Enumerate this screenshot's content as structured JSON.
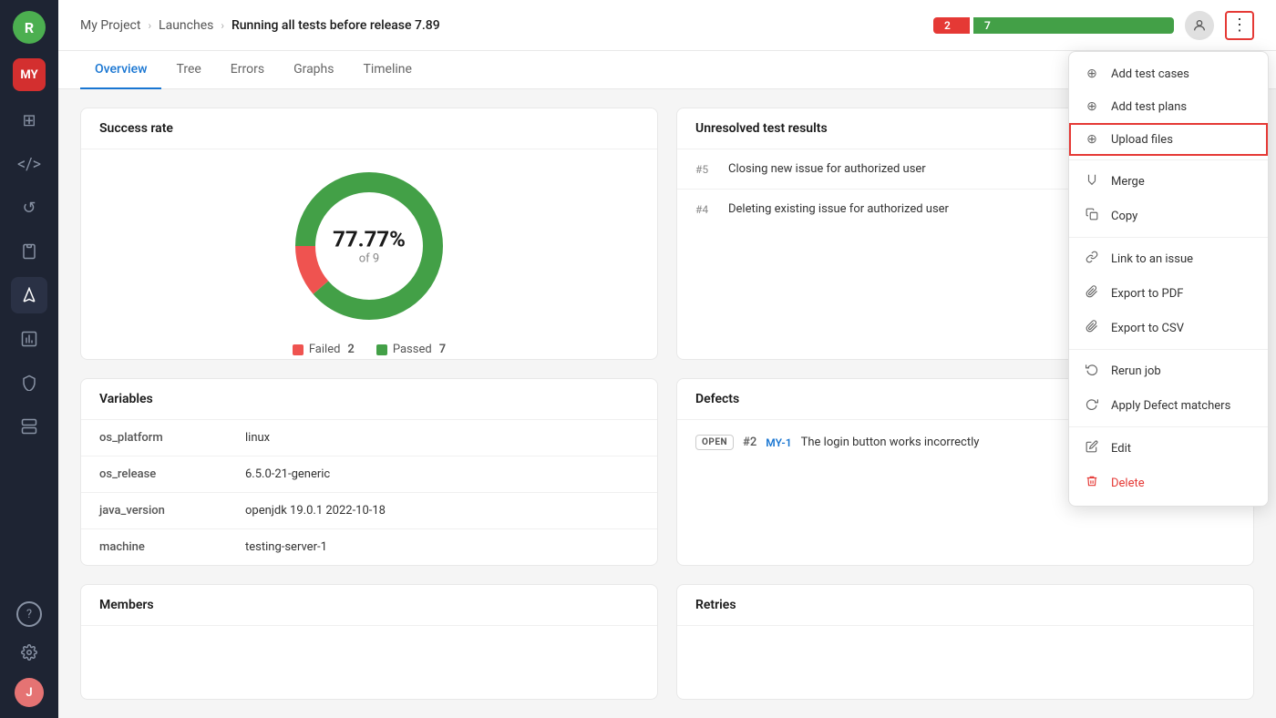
{
  "sidebar": {
    "logo_text": "R",
    "avatar_text": "MY",
    "icons": [
      {
        "name": "dashboard-icon",
        "glyph": "⊞",
        "active": false
      },
      {
        "name": "code-icon",
        "glyph": "⟨⟩",
        "active": false
      },
      {
        "name": "refresh-icon",
        "glyph": "↺",
        "active": false
      },
      {
        "name": "clipboard-icon",
        "glyph": "📋",
        "active": false
      },
      {
        "name": "launch-icon",
        "glyph": "🚀",
        "active": true
      },
      {
        "name": "chart-icon",
        "glyph": "📊",
        "active": false
      },
      {
        "name": "security-icon",
        "glyph": "🛡",
        "active": false
      },
      {
        "name": "storage-icon",
        "glyph": "🗄",
        "active": false
      }
    ],
    "bottom_icons": [
      {
        "name": "help-icon",
        "glyph": "?"
      },
      {
        "name": "settings-icon",
        "glyph": "⚙"
      },
      {
        "name": "user-icon",
        "glyph": "J",
        "is_avatar": true
      }
    ]
  },
  "breadcrumb": {
    "items": [
      "My Project",
      "Launches",
      "Running all tests before release 7.89"
    ]
  },
  "header": {
    "failed_count": "2",
    "passed_count": "7",
    "passed_bar_width": 220,
    "failed_bar_width": 40
  },
  "tabs": [
    {
      "label": "Overview",
      "active": true
    },
    {
      "label": "Tree",
      "active": false
    },
    {
      "label": "Errors",
      "active": false
    },
    {
      "label": "Graphs",
      "active": false
    },
    {
      "label": "Timeline",
      "active": false
    }
  ],
  "success_rate": {
    "title": "Success rate",
    "percent": "77.77%",
    "of": "of 9",
    "failed_count": 2,
    "passed_count": 7,
    "failed_label": "Failed",
    "passed_label": "Passed",
    "failed_color": "#ef5350",
    "passed_color": "#43a047",
    "donut_circumference": 502.65,
    "passed_dash": 390,
    "failed_dash": 112.65
  },
  "variables": {
    "title": "Variables",
    "rows": [
      {
        "key": "os_platform",
        "value": "linux"
      },
      {
        "key": "os_release",
        "value": "6.5.0-21-generic"
      },
      {
        "key": "java_version",
        "value": "openjdk 19.0.1 2022-10-18"
      },
      {
        "key": "machine",
        "value": "testing-server-1"
      }
    ]
  },
  "unresolved": {
    "title": "Unresolved test results",
    "items": [
      {
        "num": "#5",
        "text": "Closing new issue for authorized user"
      },
      {
        "num": "#4",
        "text": "Deleting existing issue for authorized user"
      }
    ]
  },
  "defects": {
    "title": "Defects",
    "items": [
      {
        "badge": "OPEN",
        "issue_num": "#2",
        "issue_link": "MY-1",
        "text": "The login button works incorrectly"
      }
    ]
  },
  "members": {
    "title": "Members"
  },
  "retries": {
    "title": "Retries"
  },
  "dropdown": {
    "items": [
      {
        "label": "Add test cases",
        "icon": "⊕",
        "highlighted": false
      },
      {
        "label": "Add test plans",
        "icon": "⊕",
        "highlighted": false
      },
      {
        "label": "Upload files",
        "icon": "⊕",
        "highlighted": true
      },
      {
        "label": "Merge",
        "icon": "⤢",
        "highlighted": false
      },
      {
        "label": "Copy",
        "icon": "⧉",
        "highlighted": false
      },
      {
        "label": "Link to an issue",
        "icon": "🔗",
        "highlighted": false
      },
      {
        "label": "Export to PDF",
        "icon": "📎",
        "highlighted": false
      },
      {
        "label": "Export to CSV",
        "icon": "📎",
        "highlighted": false
      },
      {
        "label": "Rerun job",
        "icon": "↺",
        "highlighted": false
      },
      {
        "label": "Apply Defect matchers",
        "icon": "↺",
        "highlighted": false
      },
      {
        "label": "Edit",
        "icon": "✏",
        "highlighted": false
      },
      {
        "label": "Delete",
        "icon": "🗑",
        "highlighted": false,
        "danger": true
      }
    ]
  }
}
